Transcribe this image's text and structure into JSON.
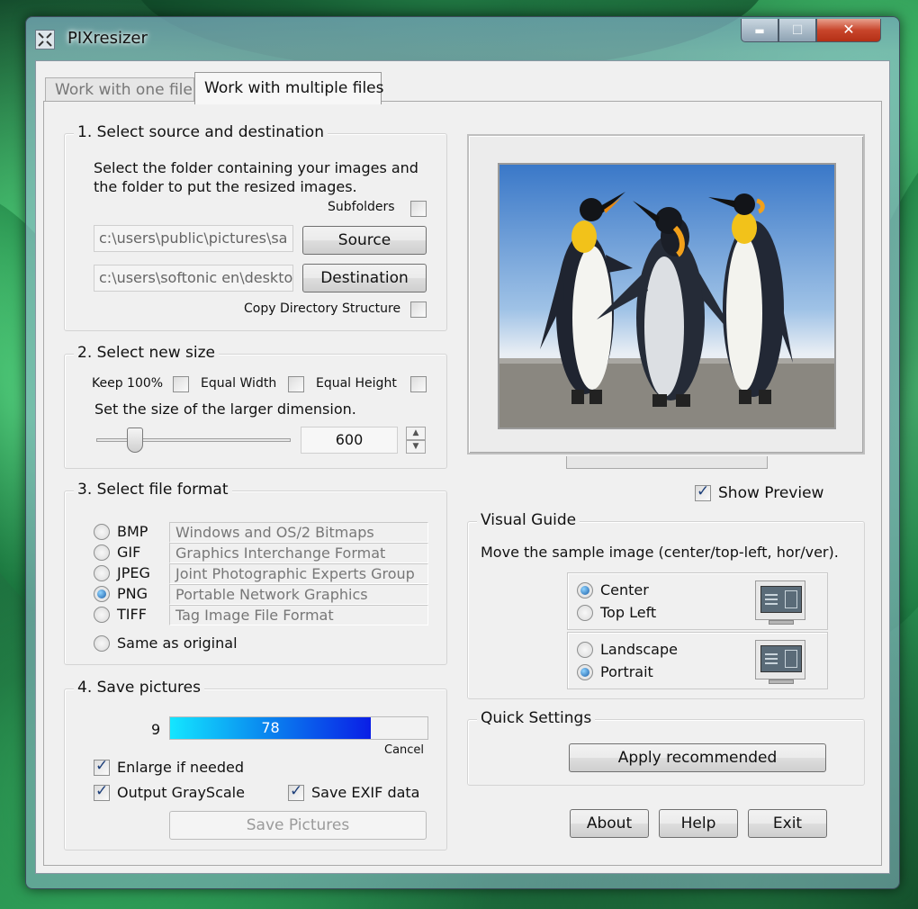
{
  "window": {
    "title": "PIXresizer",
    "controls": {
      "minimize": "▬",
      "maximize": "☐",
      "close": "✕"
    }
  },
  "tabs": [
    {
      "label": "Work with one file",
      "active": false
    },
    {
      "label": "Work with multiple files",
      "active": true
    }
  ],
  "section1": {
    "title": "1. Select source and destination",
    "description_line1": "Select the folder containing your images and",
    "description_line2": "the folder to put the resized images.",
    "subfolders_label": "Subfolders",
    "subfolders_checked": false,
    "source_path": "c:\\users\\public\\pictures\\sa",
    "source_button": "Source",
    "destination_path": "c:\\users\\softonic en\\deskto",
    "destination_button": "Destination",
    "copy_structure_label": "Copy Directory Structure",
    "copy_structure_checked": false
  },
  "section2": {
    "title": "2. Select new size",
    "keep100_label": "Keep 100%",
    "equal_width_label": "Equal Width",
    "equal_height_label": "Equal Height",
    "instruction": "Set the size of the larger dimension.",
    "size_value": "600",
    "slider_fraction": 0.2
  },
  "section3": {
    "title": "3. Select file format",
    "formats": [
      {
        "name": "BMP",
        "description": "Windows and OS/2 Bitmaps",
        "selected": false
      },
      {
        "name": "GIF",
        "description": "Graphics Interchange Format",
        "selected": false
      },
      {
        "name": "JPEG",
        "description": "Joint Photographic Experts Group",
        "selected": false
      },
      {
        "name": "PNG",
        "description": "Portable Network Graphics",
        "selected": true
      },
      {
        "name": "TIFF",
        "description": "Tag Image File Format",
        "selected": false
      }
    ],
    "same_as_original": "Same as original"
  },
  "section4": {
    "title": "4. Save pictures",
    "count": "9",
    "progress_text": "78",
    "progress_fraction": 0.78,
    "cancel_label": "Cancel",
    "enlarge_label": "Enlarge if needed",
    "enlarge_checked": true,
    "grayscale_label": "Output GrayScale",
    "grayscale_checked": true,
    "exif_label": "Save EXIF data",
    "exif_checked": true,
    "save_button": "Save Pictures"
  },
  "preview": {
    "show_preview_label": "Show Preview",
    "show_preview_checked": true
  },
  "visual_guide": {
    "title": "Visual Guide",
    "instruction": "Move the sample image (center/top-left, hor/ver).",
    "center_label": "Center",
    "top_left_label": "Top Left",
    "landscape_label": "Landscape",
    "portrait_label": "Portrait"
  },
  "quick_settings": {
    "title": "Quick Settings",
    "apply_button": "Apply recommended"
  },
  "footer": {
    "about_button": "About",
    "help_button": "Help",
    "exit_button": "Exit"
  },
  "colors": {
    "progress_start": "#14e6ff",
    "progress_end": "#0a1ee6",
    "close_button": "#c8452b"
  }
}
